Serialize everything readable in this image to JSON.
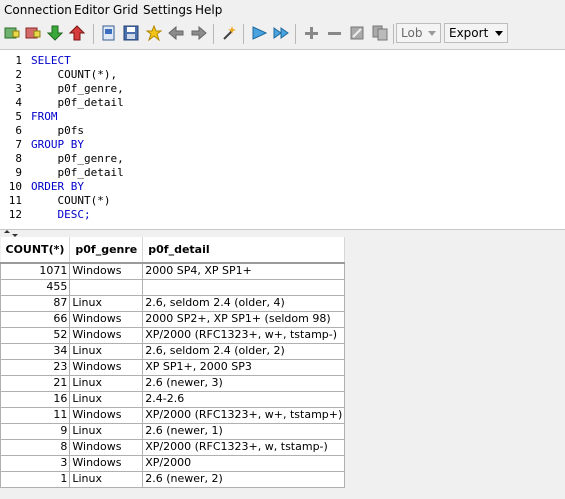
{
  "menu": [
    "Connection",
    "Editor",
    "Grid",
    "Settings",
    "Help"
  ],
  "toolbar": {
    "lob_label": "Lob",
    "export_label": "Export"
  },
  "editor": {
    "lines": [
      {
        "n": "1",
        "text": "SELECT",
        "kw": true
      },
      {
        "n": "2",
        "text": "    COUNT(*),",
        "kw": false
      },
      {
        "n": "3",
        "text": "    p0f_genre,",
        "kw": false
      },
      {
        "n": "4",
        "text": "    p0f_detail",
        "kw": false
      },
      {
        "n": "5",
        "text": "FROM",
        "kw": true
      },
      {
        "n": "6",
        "text": "    p0fs",
        "kw": false
      },
      {
        "n": "7",
        "text": "GROUP BY",
        "kw": true
      },
      {
        "n": "8",
        "text": "    p0f_genre,",
        "kw": false
      },
      {
        "n": "9",
        "text": "    p0f_detail",
        "kw": false
      },
      {
        "n": "10",
        "text": "ORDER BY",
        "kw": true
      },
      {
        "n": "11",
        "text": "    COUNT(*)",
        "kw": false
      },
      {
        "n": "12",
        "text": "    DESC;",
        "kw": true
      }
    ]
  },
  "grid": {
    "columns": [
      "COUNT(*)",
      "p0f_genre",
      "p0f_detail"
    ],
    "rows": [
      [
        "1071",
        "Windows",
        "2000 SP4, XP SP1+"
      ],
      [
        "455",
        "",
        ""
      ],
      [
        "87",
        "Linux",
        "2.6, seldom 2.4 (older, 4)"
      ],
      [
        "66",
        "Windows",
        "2000 SP2+, XP SP1+ (seldom 98)"
      ],
      [
        "52",
        "Windows",
        "XP/2000 (RFC1323+, w+, tstamp-)"
      ],
      [
        "34",
        "Linux",
        "2.6, seldom 2.4 (older, 2)"
      ],
      [
        "23",
        "Windows",
        "XP SP1+, 2000 SP3"
      ],
      [
        "21",
        "Linux",
        "2.6 (newer, 3)"
      ],
      [
        "16",
        "Linux",
        "2.4-2.6"
      ],
      [
        "11",
        "Windows",
        "XP/2000 (RFC1323+, w+, tstamp+)"
      ],
      [
        "9",
        "Linux",
        "2.6 (newer, 1)"
      ],
      [
        "8",
        "Windows",
        "XP/2000 (RFC1323+, w, tstamp-)"
      ],
      [
        "3",
        "Windows",
        "XP/2000"
      ],
      [
        "1",
        "Linux",
        "2.6 (newer, 2)"
      ]
    ]
  },
  "colors": {
    "keyword": "#0000cc",
    "background": "#f0f0f0"
  }
}
